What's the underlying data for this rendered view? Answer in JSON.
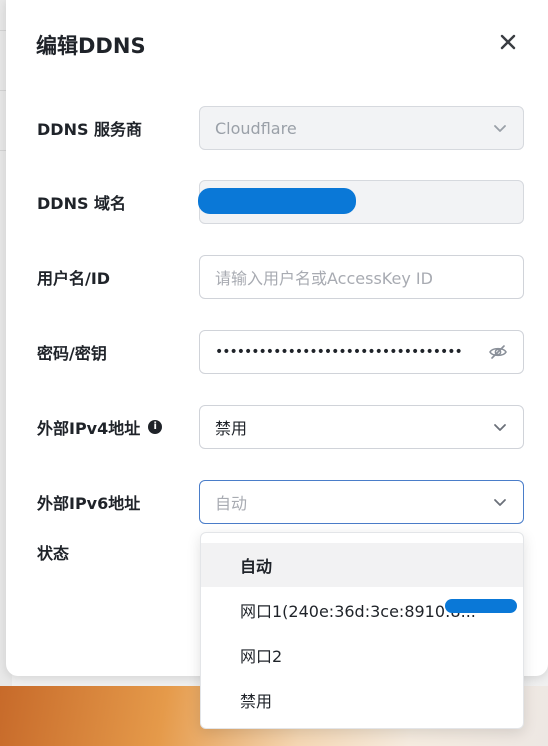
{
  "dialog": {
    "title": "编辑DDNS"
  },
  "fields": {
    "provider": {
      "label": "DDNS 服务商",
      "value": "Cloudflare"
    },
    "domain": {
      "label": "DDNS 域名",
      "value": ""
    },
    "username": {
      "label": "用户名/ID",
      "placeholder": "请输入用户名或AccessKey ID"
    },
    "password": {
      "label": "密码/密钥",
      "value": "••••••••••••••••••••••••••••••••••"
    },
    "ipv4": {
      "label": "外部IPv4地址",
      "value": "禁用"
    },
    "ipv6": {
      "label": "外部IPv6地址",
      "value": "自动"
    },
    "status": {
      "label": "状态"
    }
  },
  "dropdown": {
    "options": [
      "自动",
      "网口1(240e:36d:3ce:8910:8...",
      "网口2",
      "禁用"
    ],
    "selected_index": 0
  },
  "icons": {
    "close": "close-icon",
    "chevron": "chevron-down-icon",
    "eye": "eye-off-icon",
    "info": "info-icon"
  },
  "colors": {
    "redaction": "#0a78d7",
    "focus_border": "#4a7dc9"
  }
}
